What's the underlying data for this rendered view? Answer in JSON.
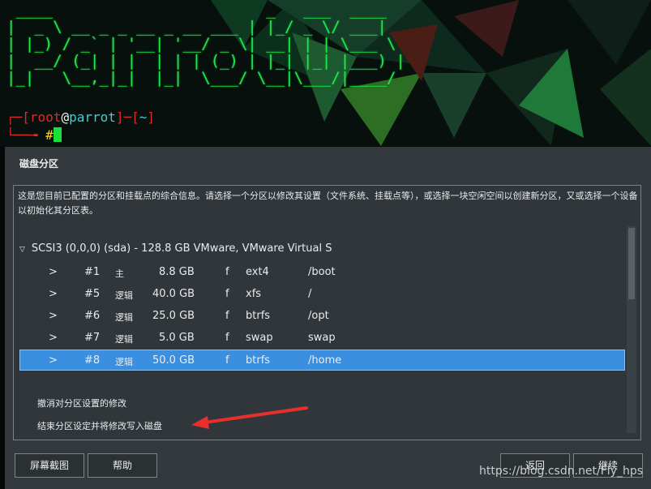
{
  "terminal": {
    "ascii_art": " ____                       _   ___  ____\n|  _ \\ __ _ _ __ _ __ ___ | |_/ _ \\/ ___|\n| |_) / _` | '__| '__/ _ \\| __| | | \\___ \\\n|  __/ (_| | |  | | | (_) | |_| |_| |___) |\n|_|   \\__,_|_|  |_|  \\___/ \\__|\\___/|____/",
    "prompt_open": "┌─[",
    "prompt_user": "root",
    "prompt_at": "@",
    "prompt_host": "parrot",
    "prompt_mid": "]─[",
    "prompt_dir": "~",
    "prompt_close": "]",
    "prompt_line2": "└──╼ ",
    "prompt_hash": "#"
  },
  "dialog": {
    "title": "磁盘分区",
    "description": "这是您目前已配置的分区和挂载点的综合信息。请选择一个分区以修改其设置（文件系统、挂载点等），或选择一块空闲空间以创建新分区，又或选择一个设备以初始化其分区表。",
    "disk": {
      "toggle": "▽",
      "label": "SCSI3 (0,0,0) (sda) - 128.8 GB VMware, VMware Virtual S"
    },
    "partitions": [
      {
        "arrow": ">",
        "num": "#1",
        "type": "主",
        "size": "8.8 GB",
        "flag": "f",
        "fs": "ext4",
        "mount": "/boot",
        "selected": false
      },
      {
        "arrow": ">",
        "num": "#5",
        "type": "逻辑",
        "size": "40.0 GB",
        "flag": "f",
        "fs": "xfs",
        "mount": "/",
        "selected": false
      },
      {
        "arrow": ">",
        "num": "#6",
        "type": "逻辑",
        "size": "25.0 GB",
        "flag": "f",
        "fs": "btrfs",
        "mount": "/opt",
        "selected": false
      },
      {
        "arrow": ">",
        "num": "#7",
        "type": "逻辑",
        "size": "5.0 GB",
        "flag": "f",
        "fs": "swap",
        "mount": "swap",
        "selected": false
      },
      {
        "arrow": ">",
        "num": "#8",
        "type": "逻辑",
        "size": "50.0 GB",
        "flag": "f",
        "fs": "btrfs",
        "mount": "/home",
        "selected": true
      }
    ],
    "actions": {
      "undo": "撤消对分区设置的修改",
      "finish": "结束分区设定并将修改写入磁盘"
    },
    "buttons": {
      "screenshot": "屏幕截图",
      "help": "帮助",
      "back": "返回",
      "continue": "继续"
    }
  },
  "colors": {
    "selection": "#3a8fe0",
    "arrow": "#e8302a",
    "terminal_green": "#24e84a"
  },
  "watermark": "https://blog.csdn.net/Fly_hps"
}
